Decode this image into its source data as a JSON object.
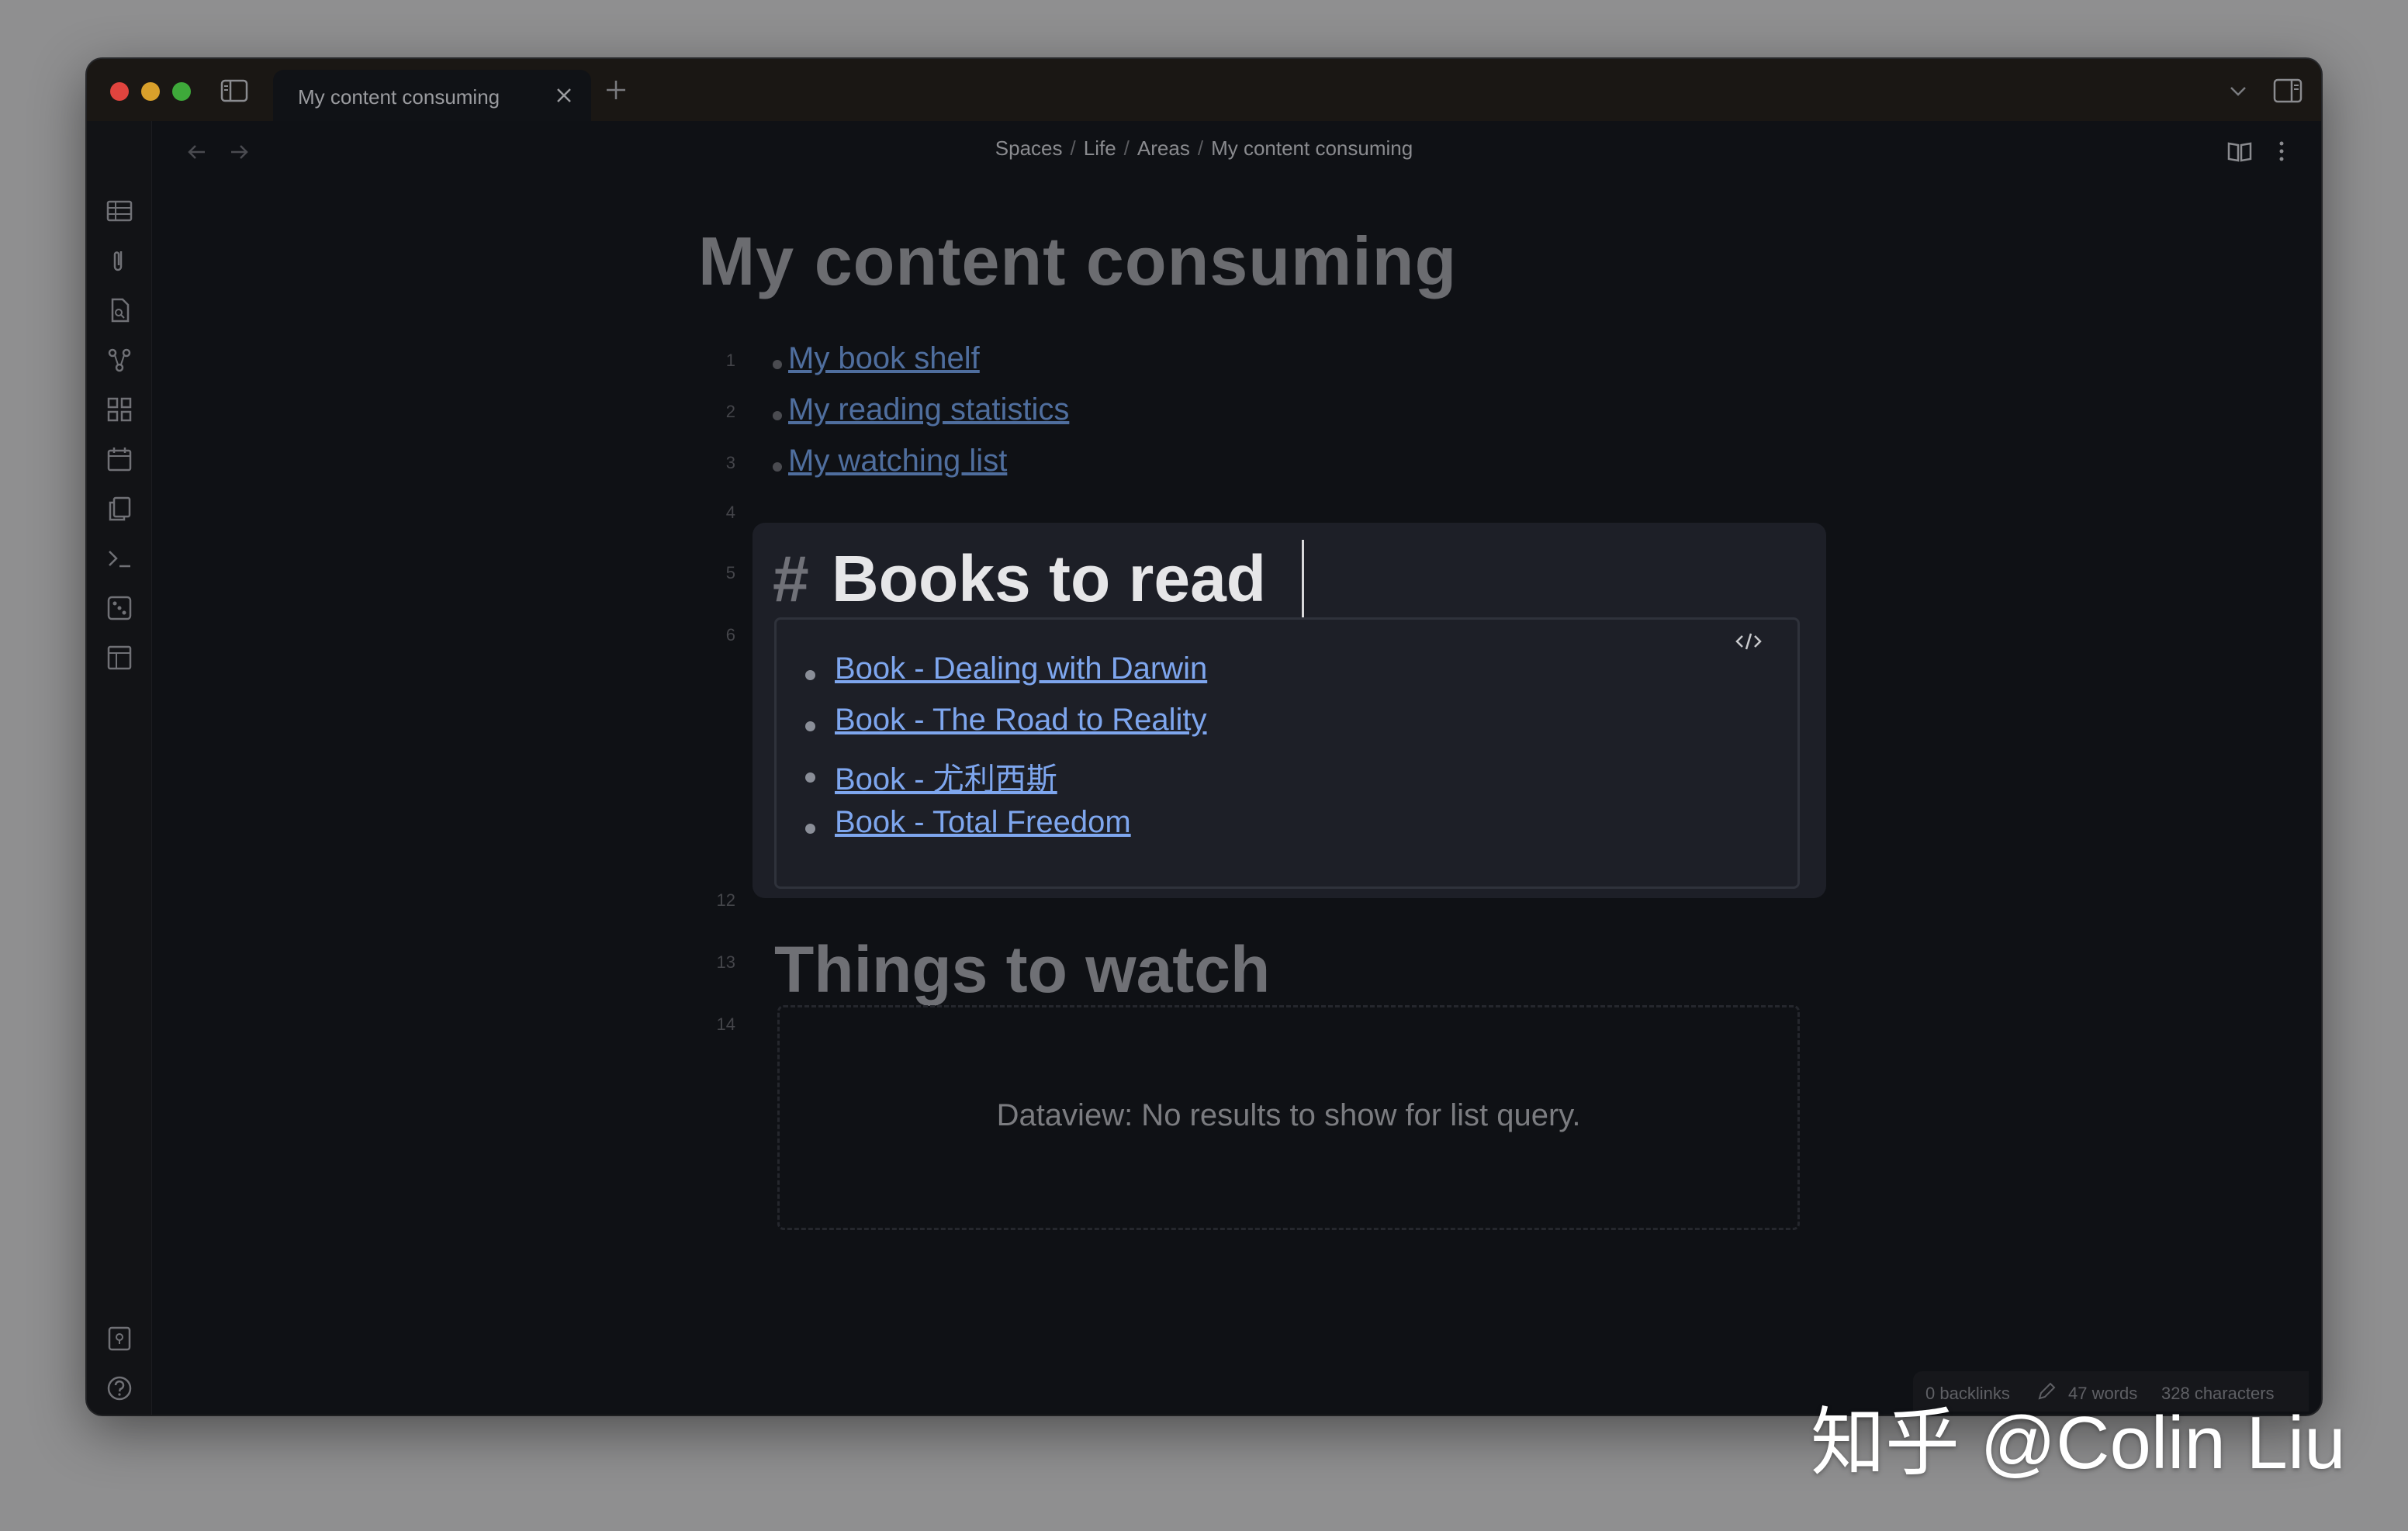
{
  "window": {
    "tab_title": "My content consuming"
  },
  "breadcrumb": [
    "Spaces",
    "Life",
    "Areas",
    "My content consuming"
  ],
  "document": {
    "title": "My content consuming",
    "links": [
      {
        "line": "1",
        "text": "My book shelf"
      },
      {
        "line": "2",
        "text": "My reading statistics"
      },
      {
        "line": "3",
        "text": "My watching list"
      }
    ],
    "extra_lines": [
      "4",
      "5",
      "6",
      "12",
      "13",
      "14"
    ],
    "section1": {
      "hash": "#",
      "heading": "Books to read",
      "books": [
        "Book - Dealing with Darwin",
        "Book - The Road to Reality",
        "Book - 尤利西斯",
        "Book - Total Freedom"
      ]
    },
    "section2": {
      "heading": "Things to watch",
      "empty_message": "Dataview: No results to show for list query."
    }
  },
  "statusbar": {
    "backlinks": "0 backlinks",
    "words": "47 words",
    "characters": "328 characters"
  },
  "watermark": "知乎 @Colin Liu",
  "icons": [
    "sidebar-toggle-icon",
    "close-icon",
    "plus-icon",
    "chevron-down-icon",
    "right-sidebar-icon",
    "table-icon",
    "paperclip-icon",
    "file-search-icon",
    "graph-icon",
    "grid-icon",
    "calendar-icon",
    "copy-icon",
    "terminal-icon",
    "dice-icon",
    "layout-icon",
    "vault-icon",
    "help-icon",
    "gear-icon",
    "arrow-left-icon",
    "arrow-right-icon",
    "book-open-icon",
    "more-vertical-icon",
    "code-icon",
    "pencil-icon"
  ]
}
